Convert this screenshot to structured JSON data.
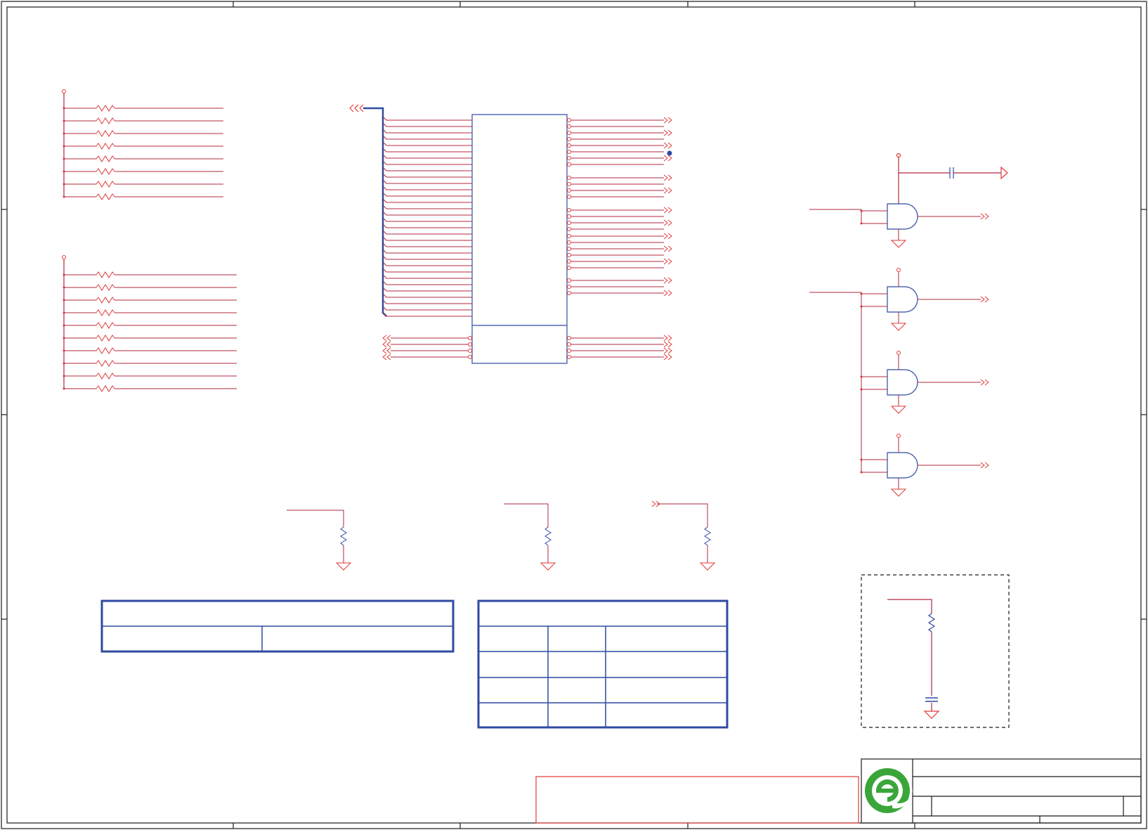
{
  "sheet": {
    "logo": "company-logo",
    "colors": {
      "wire": "#b0283c",
      "pin": "#e03a3a",
      "body": "#2f4aa0",
      "frame": "#1a1a1a",
      "logo_green": "#3aa63a"
    }
  },
  "components": {
    "pullup_bank_top_count": 8,
    "pullup_bank_bottom_count": 10,
    "ic_left_pin_count": 32,
    "ic_bottom_pin_count": 4,
    "and_gate_count": 4,
    "pulldown_resistor_count": 3
  },
  "table_left": {
    "rows": 2,
    "columns": 2
  },
  "table_right": {
    "rows": 5,
    "columns": 3
  }
}
